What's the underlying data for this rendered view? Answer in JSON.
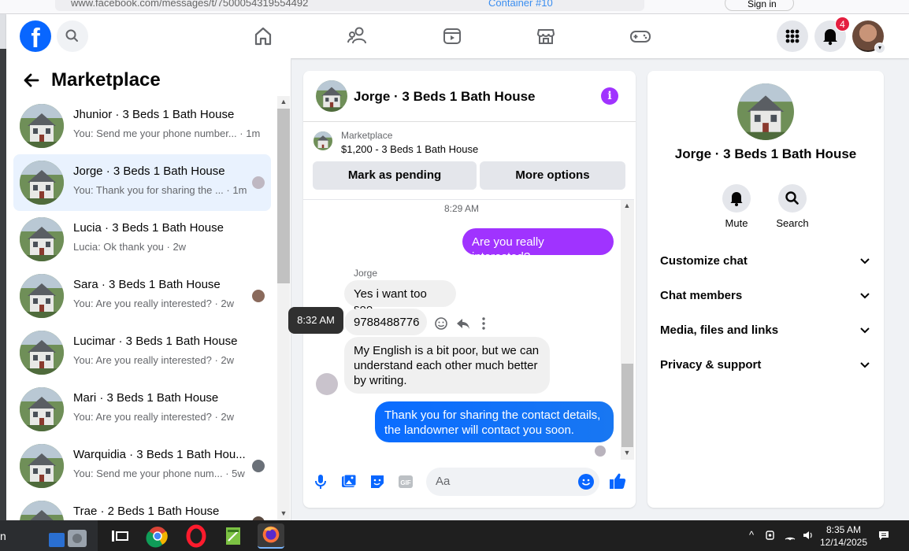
{
  "browser": {
    "url": "www.facebook.com/messages/t/7500054319554492",
    "container_label": "Container #10",
    "signin_label": "Sign in"
  },
  "header": {
    "logo": "f",
    "notification_count": "4",
    "icons": [
      "search-icon",
      "home-icon",
      "friends-icon",
      "watch-icon",
      "marketplace-icon",
      "gaming-icon",
      "menu-grid-icon",
      "notifications-icon"
    ]
  },
  "sidebar": {
    "title": "Marketplace",
    "conversations": [
      {
        "name": "Jhunior · 3 Beds 1 Bath House",
        "preview": "You: Send me your phone number... · 1m",
        "active": false
      },
      {
        "name": "Jorge · 3 Beds 1 Bath House",
        "preview": "You: Thank you for sharing the ... · 1m",
        "active": true
      },
      {
        "name": "Lucia · 3 Beds 1 Bath House",
        "preview": "Lucia: Ok thank you · 2w",
        "active": false
      },
      {
        "name": "Sara · 3 Beds 1 Bath House",
        "preview": "You: Are you really interested? · 2w",
        "active": false
      },
      {
        "name": "Lucimar · 3 Beds 1 Bath House",
        "preview": "You: Are you really interested? · 2w",
        "active": false
      },
      {
        "name": "Mari · 3 Beds 1 Bath House",
        "preview": "You: Are you really interested? · 2w",
        "active": false
      },
      {
        "name": "Warquidia · 3 Beds 1 Bath Hou...",
        "preview": "You: Send me your phone num... · 5w",
        "active": false
      },
      {
        "name": "Trae · 2 Beds 1 Bath House",
        "preview": "",
        "active": false
      }
    ]
  },
  "chat": {
    "title": "Jorge · 3 Beds 1 Bath House",
    "listing": {
      "source": "Marketplace",
      "title": "$1,200 - 3 Beds 1 Bath House"
    },
    "buttons": {
      "mark_pending": "Mark as pending",
      "more_options": "More options"
    },
    "timestamp": "8:29 AM",
    "messages": {
      "out1": "Are you really interested?",
      "sender": "Jorge",
      "in1": "Yes i want too see",
      "in2": "9788488776",
      "in3": "My English is a bit poor, but we can understand each other much better by writing.",
      "out2": "Thank you for sharing the contact details, the landowner will contact you soon."
    },
    "tooltip": "8:32 AM",
    "composer_placeholder": "Aa"
  },
  "details": {
    "title": "Jorge · 3 Beds 1 Bath House",
    "actions": {
      "mute": "Mute",
      "search": "Search"
    },
    "sections": [
      "Customize chat",
      "Chat members",
      "Media, files and links",
      "Privacy & support"
    ]
  },
  "taskbar": {
    "time": "8:35 AM",
    "date": "12/14/2025",
    "edge_letter": "n"
  },
  "colors": {
    "fb_blue": "#0866ff",
    "purple_accent": "#a033ff",
    "active_row": "#e9f2fe"
  }
}
